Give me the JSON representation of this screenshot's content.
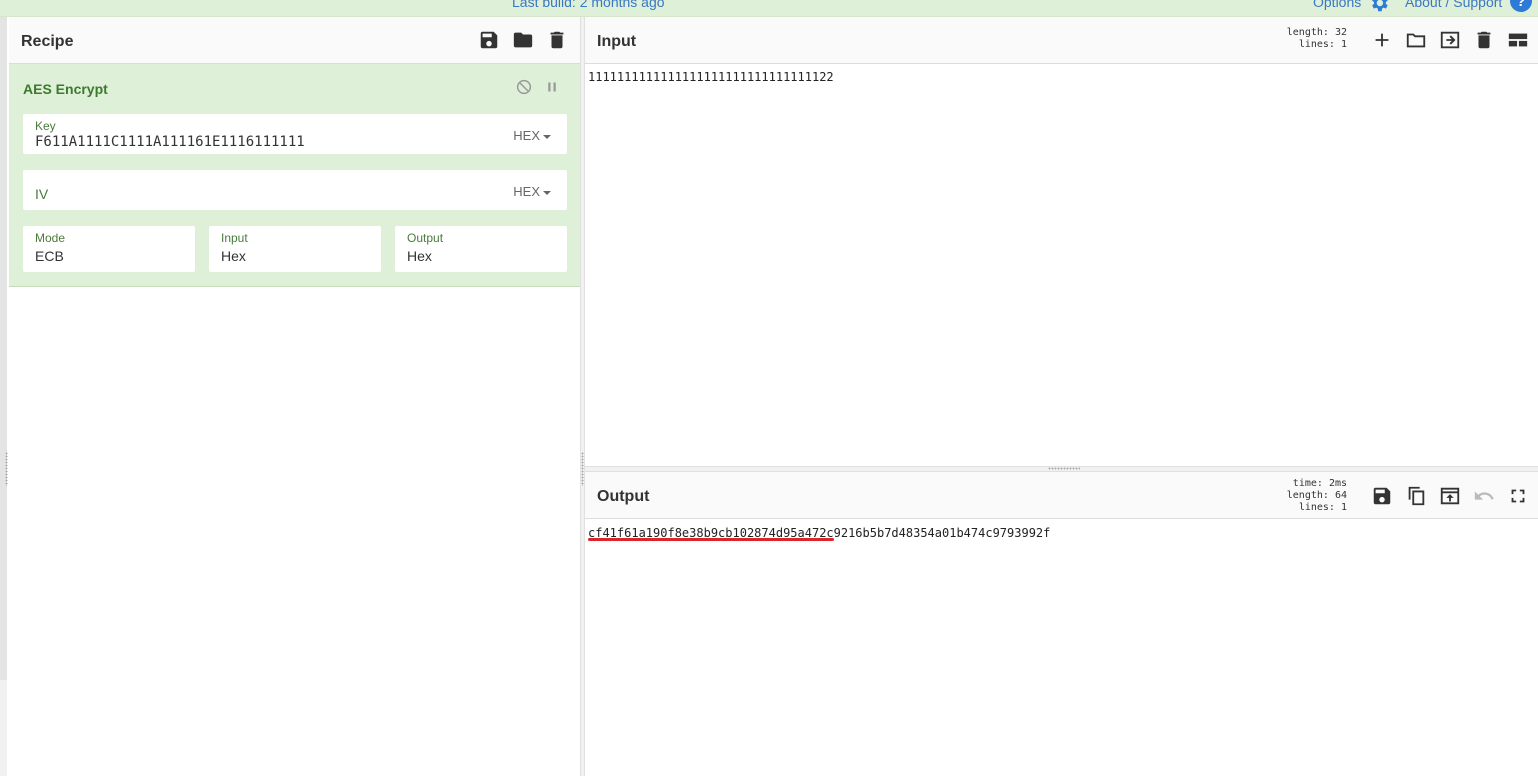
{
  "banner": {
    "last_build": "Last build: 2 months ago",
    "options_label": "Options",
    "about_label": "About / Support",
    "help_glyph": "?"
  },
  "recipe": {
    "title": "Recipe",
    "icons": [
      "save-icon",
      "folder-icon",
      "trash-icon"
    ],
    "operation": {
      "name": "AES Encrypt",
      "icons": [
        "disable-icon",
        "pause-icon"
      ],
      "key": {
        "label": "Key",
        "value": "F611A1111C1111A111161E1116111111",
        "format": "HEX"
      },
      "iv": {
        "placeholder": "IV",
        "format": "HEX"
      },
      "mode": {
        "label": "Mode",
        "value": "ECB"
      },
      "input": {
        "label": "Input",
        "value": "Hex"
      },
      "output": {
        "label": "Output",
        "value": "Hex"
      }
    }
  },
  "input_panel": {
    "title": "Input",
    "stats": {
      "length_label": "length:",
      "length": "32",
      "lines_label": "lines:",
      "lines": "1"
    },
    "text": "1111111111111111111111111111111122",
    "icons": [
      "plus-icon",
      "folder-icon",
      "insert-icon",
      "trash-icon",
      "layout-icon"
    ]
  },
  "output_panel": {
    "title": "Output",
    "stats": {
      "time_label": "time:",
      "time": "2ms",
      "length_label": "length:",
      "length": "64",
      "lines_label": "lines:",
      "lines": "1"
    },
    "text": "cf41f61a190f8e38b9cb102874d95a472c9216b5b7d48354a01b474c9793992f",
    "icons": [
      "save-icon",
      "copy-icon",
      "replace-input-icon",
      "undo-icon",
      "fullscreen-icon"
    ]
  },
  "colors": {
    "banner_bg": "#dff0d8",
    "operation_bg": "#dff0d8",
    "link_blue": "#3a78c3",
    "highlight_red": "#d9262b"
  }
}
